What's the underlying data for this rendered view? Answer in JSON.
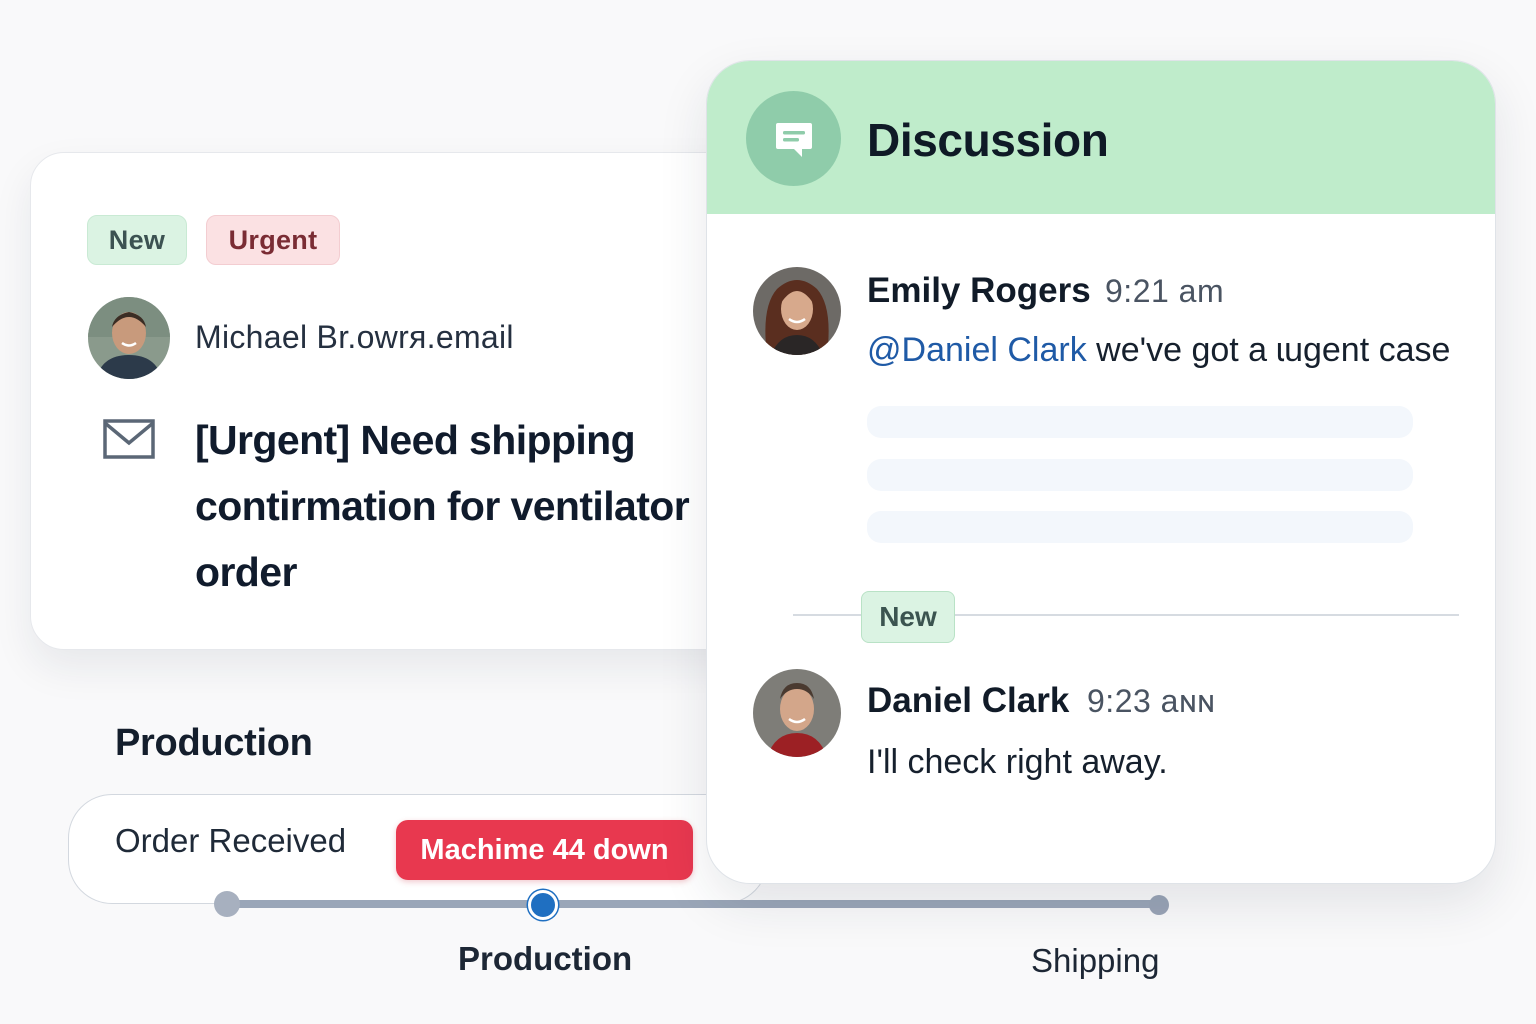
{
  "email": {
    "tags": {
      "new": "New",
      "urgent": "Urgent"
    },
    "sender": "Michael Br.owrя.email",
    "subject": "[Urgent] Need shipping contirmation for ventilator order"
  },
  "production": {
    "section_title": "Production",
    "order_received": "Order Received",
    "alert": "Machime 44 down",
    "stages": [
      "Production",
      "Shipping"
    ],
    "current_stage": "Production"
  },
  "discussion": {
    "title": "Discussion",
    "messages": [
      {
        "author": "Emily Rogers",
        "time": "9:21 am",
        "mention": "@Daniel Clark",
        "text": " we've got a ɩugent case"
      },
      {
        "author": "Daniel Clark",
        "time": "9:23 aɴɴ",
        "text": "I'll check right away."
      }
    ],
    "new_divider_label": "New"
  },
  "colors": {
    "header_green": "#bfeccb",
    "alert_red": "#e8384f",
    "mention_blue": "#1f5aa6",
    "active_stage": "#1f6fc1"
  },
  "icons": [
    "mail-icon",
    "chat-bubble-icon",
    "avatar-photo"
  ]
}
